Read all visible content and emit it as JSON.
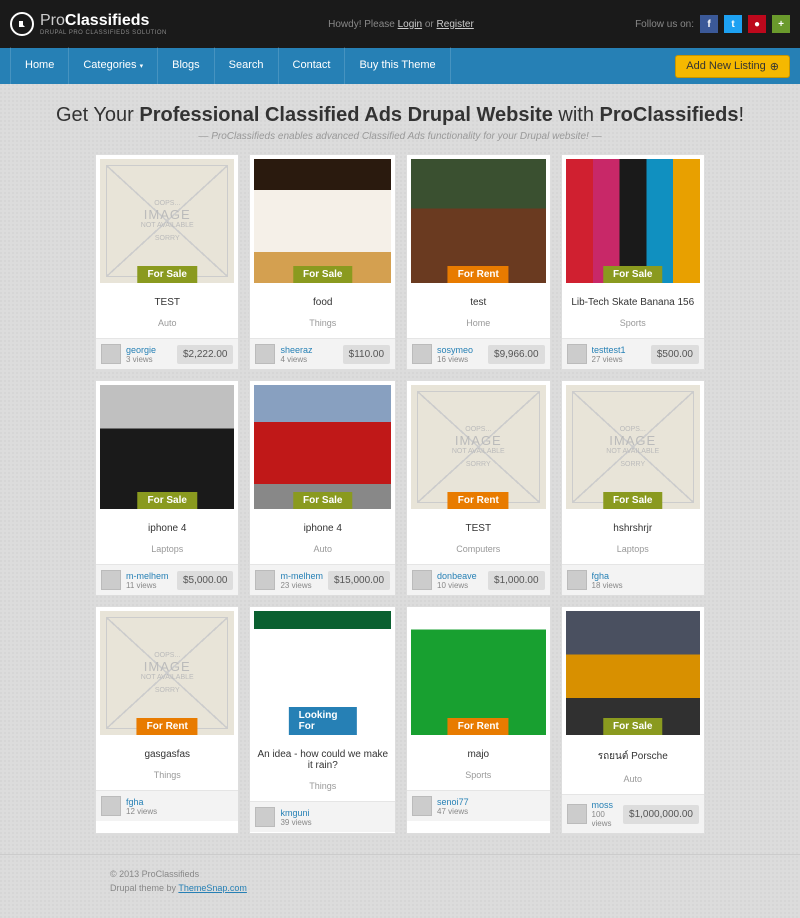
{
  "header": {
    "logo_pro": "Pro",
    "logo_classifieds": "Classifieds",
    "logo_sub": "DRUPAL PRO CLASSIFIEDS SOLUTION",
    "greeting_pre": "Howdy! Please ",
    "login": "Login",
    "or": " or ",
    "register": "Register",
    "follow": "Follow us on:"
  },
  "nav": {
    "items": [
      "Home",
      "Categories",
      "Blogs",
      "Search",
      "Contact",
      "Buy this Theme"
    ],
    "add_btn": "Add New Listing"
  },
  "hero": {
    "t1": "Get Your ",
    "t2": "Professional Classified Ads Drupal Website",
    "t3": " with ",
    "t4": "ProClassifieds",
    "t5": "!",
    "sub": "— ProClassifieds enables advanced Classified Ads functionality for your Drupal website! —"
  },
  "ph": {
    "l1": "OOPS...",
    "l2": "IMAGE",
    "l3": "NOT AVAILABLE",
    "l4": "SORRY"
  },
  "labels": {
    "sale": "For Sale",
    "rent": "For Rent",
    "look": "Looking For",
    "views_suffix": " views"
  },
  "listings": [
    {
      "img": "ph",
      "badge": "sale",
      "title": "TEST",
      "cat": "Auto",
      "user": "georgie",
      "views": "3",
      "price": "$2,222.00"
    },
    {
      "img": "img-cake",
      "badge": "sale",
      "title": "food",
      "cat": "Things",
      "user": "sheeraz",
      "views": "4",
      "price": "$110.00"
    },
    {
      "img": "img-window",
      "badge": "rent",
      "title": "test",
      "cat": "Home",
      "user": "sosymeo",
      "views": "16",
      "price": "$9,966.00"
    },
    {
      "img": "img-skate",
      "badge": "sale",
      "title": "Lib-Tech Skate Banana 156",
      "cat": "Sports",
      "user": "testtest1",
      "views": "27",
      "price": "$500.00"
    },
    {
      "img": "img-car1",
      "badge": "sale",
      "title": "iphone 4",
      "cat": "Laptops",
      "user": "m-melhem",
      "views": "11",
      "price": "$5,000.00"
    },
    {
      "img": "img-car2",
      "badge": "sale",
      "title": "iphone 4",
      "cat": "Auto",
      "user": "m-melhem",
      "views": "23",
      "price": "$15,000.00"
    },
    {
      "img": "ph",
      "badge": "rent",
      "title": "TEST",
      "cat": "Computers",
      "user": "donbeave",
      "views": "10",
      "price": "$1,000.00"
    },
    {
      "img": "ph",
      "badge": "sale",
      "title": "hshrshrjr",
      "cat": "Laptops",
      "user": "fgha",
      "views": "18",
      "price": ""
    },
    {
      "img": "ph",
      "badge": "rent",
      "title": "gasgasfas",
      "cat": "Things",
      "user": "fgha",
      "views": "12",
      "price": ""
    },
    {
      "img": "img-web",
      "badge": "look",
      "title": "An idea - how could we make it rain?",
      "cat": "Things",
      "user": "kmguni",
      "views": "39",
      "price": ""
    },
    {
      "img": "img-majo",
      "badge": "rent",
      "title": "majo",
      "cat": "Sports",
      "user": "senoi77",
      "views": "47",
      "price": ""
    },
    {
      "img": "img-porsche",
      "badge": "sale",
      "title": "รถยนต์ Porsche",
      "cat": "Auto",
      "user": "moss",
      "views": "100",
      "price": "$1,000,000.00"
    }
  ],
  "footer": {
    "copy": "© 2013 ProClassifieds",
    "theme_pre": "Drupal theme by ",
    "theme_link": "ThemeSnap.com"
  }
}
